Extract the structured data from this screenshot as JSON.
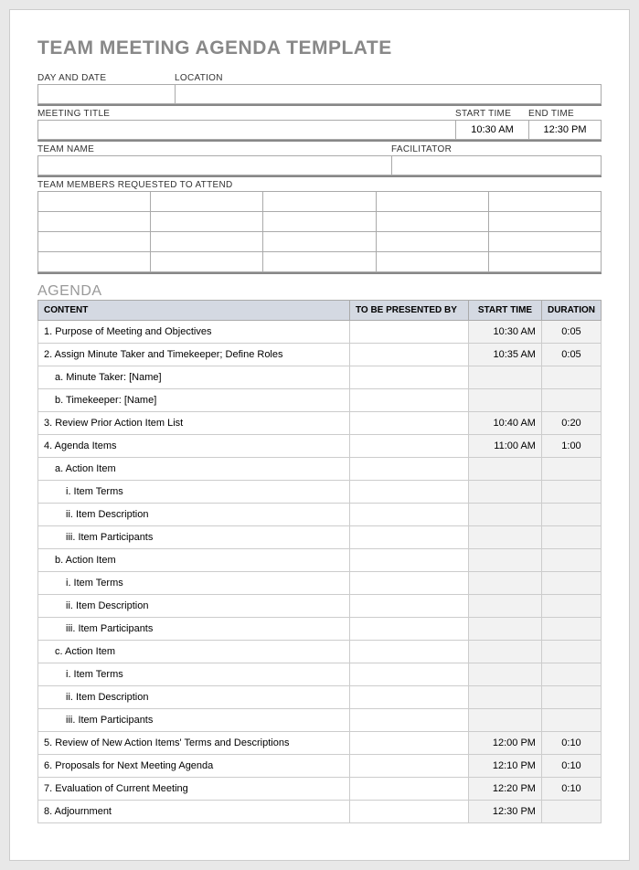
{
  "title": "TEAM MEETING AGENDA TEMPLATE",
  "labels": {
    "day_date": "DAY AND DATE",
    "location": "LOCATION",
    "meeting_title": "MEETING TITLE",
    "start_time": "START TIME",
    "end_time": "END TIME",
    "team_name": "TEAM NAME",
    "facilitator": "FACILITATOR",
    "members": "TEAM MEMBERS REQUESTED TO ATTEND"
  },
  "values": {
    "day_date": "",
    "location": "",
    "meeting_title": "",
    "start_time": "10:30 AM",
    "end_time": "12:30 PM",
    "team_name": "",
    "facilitator": ""
  },
  "agenda_heading": "AGENDA",
  "agenda_headers": {
    "content": "CONTENT",
    "presented": "TO BE PRESENTED BY",
    "start": "START TIME",
    "duration": "DURATION"
  },
  "agenda": [
    {
      "content": "1. Purpose of Meeting and Objectives",
      "indent": 0,
      "presented": "",
      "start": "10:30 AM",
      "duration": "0:05",
      "shade": true
    },
    {
      "content": "2. Assign Minute Taker and Timekeeper; Define Roles",
      "indent": 0,
      "presented": "",
      "start": "10:35 AM",
      "duration": "0:05",
      "shade": true
    },
    {
      "content": "a. Minute Taker: [Name]",
      "indent": 1,
      "presented": "",
      "start": "",
      "duration": "",
      "shade": true
    },
    {
      "content": "b. Timekeeper: [Name]",
      "indent": 1,
      "presented": "",
      "start": "",
      "duration": "",
      "shade": true
    },
    {
      "content": "3. Review Prior Action Item List",
      "indent": 0,
      "presented": "",
      "start": "10:40 AM",
      "duration": "0:20",
      "shade": true
    },
    {
      "content": "4. Agenda Items",
      "indent": 0,
      "presented": "",
      "start": "11:00 AM",
      "duration": "1:00",
      "shade": true
    },
    {
      "content": "a. Action Item",
      "indent": 1,
      "presented": "",
      "start": "",
      "duration": "",
      "shade": true
    },
    {
      "content": "i. Item Terms",
      "indent": 2,
      "presented": "",
      "start": "",
      "duration": "",
      "shade": true
    },
    {
      "content": "ii. Item Description",
      "indent": 2,
      "presented": "",
      "start": "",
      "duration": "",
      "shade": true
    },
    {
      "content": "iii. Item Participants",
      "indent": 2,
      "presented": "",
      "start": "",
      "duration": "",
      "shade": true
    },
    {
      "content": "b. Action Item",
      "indent": 1,
      "presented": "",
      "start": "",
      "duration": "",
      "shade": true
    },
    {
      "content": "i. Item Terms",
      "indent": 2,
      "presented": "",
      "start": "",
      "duration": "",
      "shade": true
    },
    {
      "content": "ii. Item Description",
      "indent": 2,
      "presented": "",
      "start": "",
      "duration": "",
      "shade": true
    },
    {
      "content": "iii. Item Participants",
      "indent": 2,
      "presented": "",
      "start": "",
      "duration": "",
      "shade": true
    },
    {
      "content": "c. Action Item",
      "indent": 1,
      "presented": "",
      "start": "",
      "duration": "",
      "shade": true
    },
    {
      "content": "i. Item Terms",
      "indent": 2,
      "presented": "",
      "start": "",
      "duration": "",
      "shade": true
    },
    {
      "content": "ii. Item Description",
      "indent": 2,
      "presented": "",
      "start": "",
      "duration": "",
      "shade": true
    },
    {
      "content": "iii. Item Participants",
      "indent": 2,
      "presented": "",
      "start": "",
      "duration": "",
      "shade": true
    },
    {
      "content": "5. Review of New Action Items' Terms and Descriptions",
      "indent": 0,
      "presented": "",
      "start": "12:00 PM",
      "duration": "0:10",
      "shade": true
    },
    {
      "content": "6. Proposals for Next Meeting Agenda",
      "indent": 0,
      "presented": "",
      "start": "12:10 PM",
      "duration": "0:10",
      "shade": true
    },
    {
      "content": "7. Evaluation of Current Meeting",
      "indent": 0,
      "presented": "",
      "start": "12:20 PM",
      "duration": "0:10",
      "shade": true
    },
    {
      "content": "8. Adjournment",
      "indent": 0,
      "presented": "",
      "start": "12:30 PM",
      "duration": "",
      "shade": true
    }
  ]
}
